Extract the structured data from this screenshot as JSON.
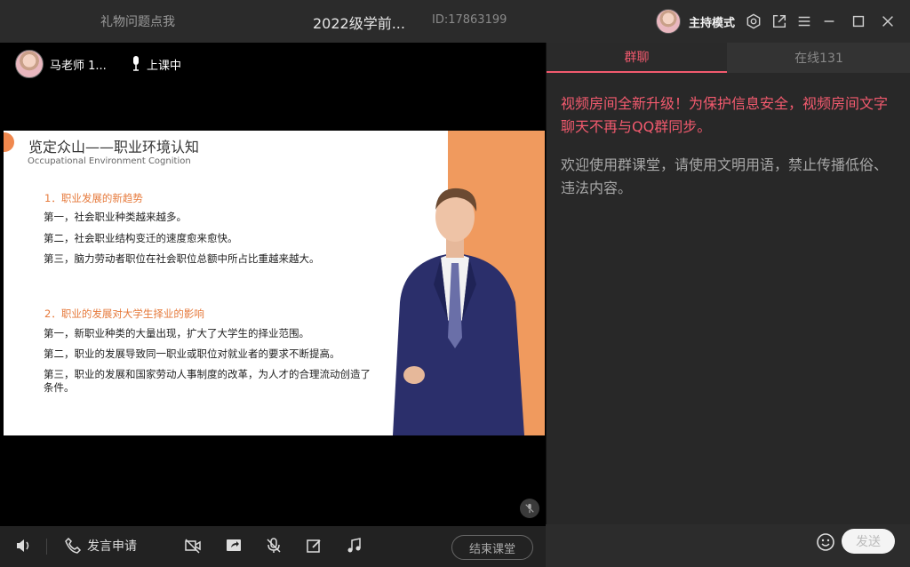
{
  "titlebar": {
    "gift_label": "礼物问题点我",
    "class_title": "2022级学前...",
    "room_id": "ID:17863199",
    "host_mode": "主持模式"
  },
  "video": {
    "teacher_name": "马老师 1...",
    "status": "上课中"
  },
  "slide": {
    "title": "览定众山——职业环境认知",
    "subtitle": "Occupational Environment Cognition",
    "section1": "1．职业发展的新趋势",
    "s1_lines": [
      "第一，社会职业种类越来越多。",
      "第二，社会职业结构变迁的速度愈来愈快。",
      "第三，脑力劳动者职位在社会职位总额中所占比重越来越大。"
    ],
    "section2": "2．职业的发展对大学生择业的影响",
    "s2_lines": [
      "第一，新职业种类的大量出现，扩大了大学生的择业范围。",
      "第二，职业的发展导致同一职业或职位对就业者的要求不断提高。",
      "第三，职业的发展和国家劳动人事制度的改革，为人才的合理流动创造了条件。"
    ]
  },
  "toolbar": {
    "apply_speak": "发言申请",
    "end_class": "结束课堂"
  },
  "chat": {
    "tab_group": "群聊",
    "tab_online": "在线131",
    "notice": "视频房间全新升级！为保护信息安全，视频房间文字聊天不再与QQ群同步。",
    "welcome": "欢迎使用群课堂，请使用文明用语，禁止传播低俗、违法内容。",
    "input_value": "",
    "send_label": "发送"
  },
  "colors": {
    "accent": "#f25a6e",
    "slide_orange": "#f09a5e",
    "section_orange": "#e67a3c"
  }
}
